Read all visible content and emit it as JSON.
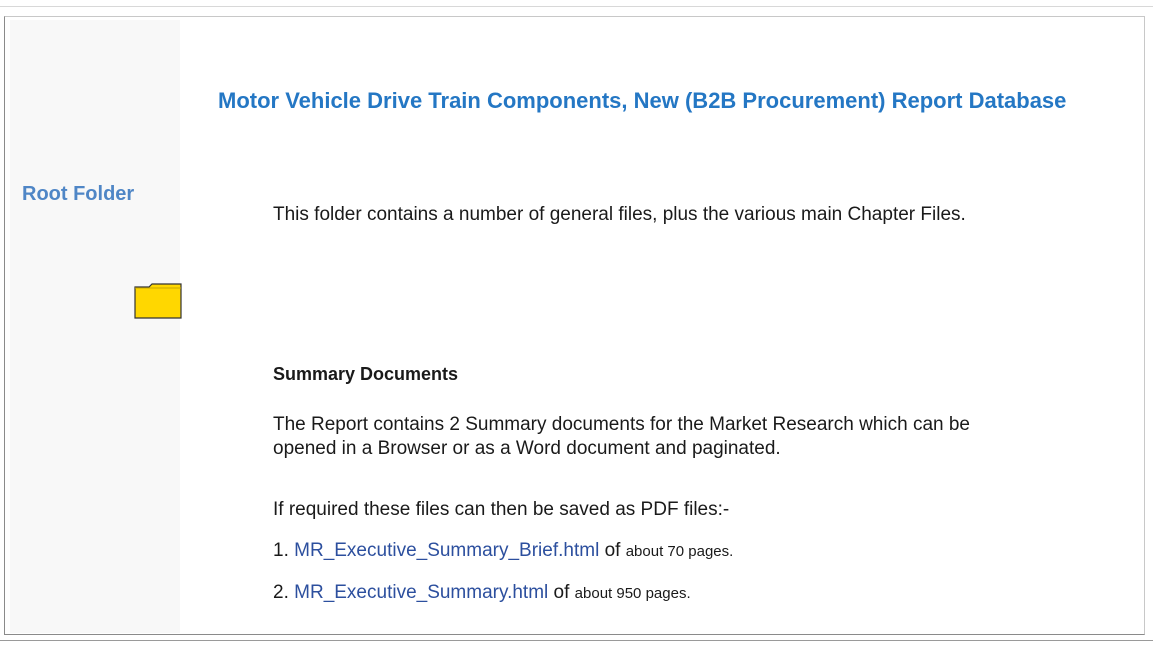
{
  "sidebar": {
    "label": "Root Folder",
    "icon": "folder-icon",
    "icon_fill": "#ffd700",
    "icon_stroke": "#333333"
  },
  "main": {
    "title": "Motor Vehicle Drive Train Components, New (B2B Procurement) Report Database",
    "intro": "This folder contains a number of general files, plus the various main Chapter Files.",
    "summary_heading": "Summary Documents",
    "summary_description": "The Report contains 2 Summary documents for the Market Research which can be opened in a Browser or as a Word document and paginated.",
    "pdf_note": "If required these files can then be saved as PDF files:-",
    "files": [
      {
        "number": "1.",
        "name": "MR_Executive_Summary_Brief.html",
        "pages_prefix": "of",
        "pages": "about 70 pages."
      },
      {
        "number": "2.",
        "name": "MR_Executive_Summary.html",
        "pages_prefix": "of",
        "pages": "about 950 pages."
      }
    ]
  },
  "colors": {
    "title": "#2477c4",
    "sidebar_label": "#4f86c6",
    "link": "#2c4f9e",
    "sidebar_bg": "#f8f8f8"
  }
}
